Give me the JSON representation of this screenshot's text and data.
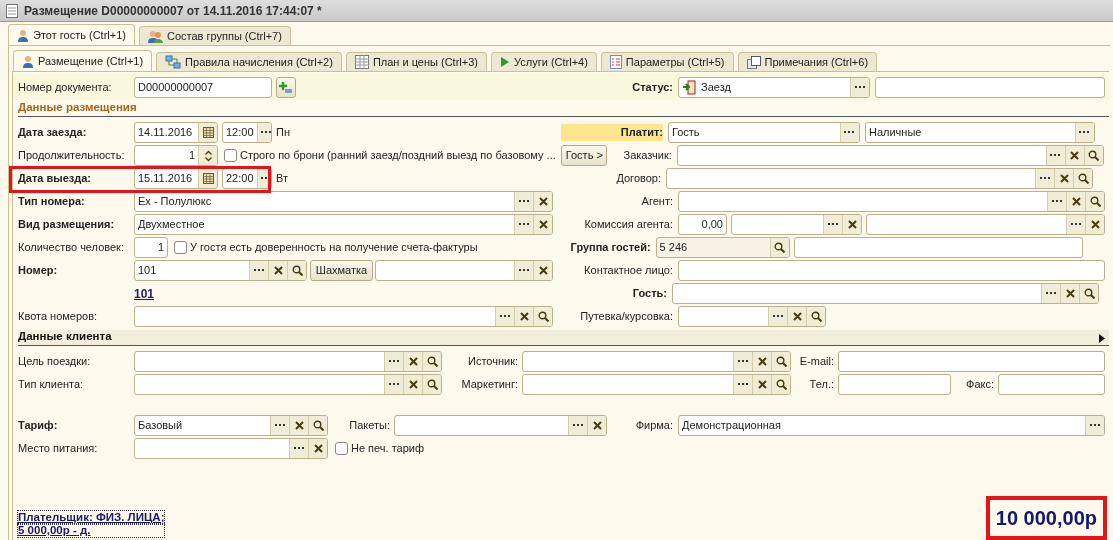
{
  "window": {
    "title": "Размещение D00000000007 от 14.11.2016 17:44:07 *"
  },
  "outer_tabs": [
    {
      "label": "Этот гость (Ctrl+1)",
      "selected": true
    },
    {
      "label": "Состав группы (Ctrl+7)",
      "selected": false
    }
  ],
  "tabs": [
    {
      "label": "Размещение (Ctrl+1)",
      "selected": true,
      "kind": "person"
    },
    {
      "label": "Правила начисления (Ctrl+2)",
      "selected": false,
      "kind": "rules"
    },
    {
      "label": "План и цены (Ctrl+3)",
      "selected": false,
      "kind": "table"
    },
    {
      "label": "Услуги (Ctrl+4)",
      "selected": false,
      "kind": "play"
    },
    {
      "label": "Параметры (Ctrl+5)",
      "selected": false,
      "kind": "list"
    },
    {
      "label": "Примечания (Ctrl+6)",
      "selected": false,
      "kind": "note"
    }
  ],
  "doc_number": {
    "label": "Номер документа:",
    "value": "D00000000007"
  },
  "status": {
    "label": "Статус:",
    "value": "Заезд"
  },
  "placement": {
    "title": "Данные размещения",
    "arrival": {
      "label": "Дата заезда:",
      "date": "14.11.2016",
      "time": "12:00",
      "weekday": "Пн"
    },
    "duration": {
      "label": "Продолжительность:",
      "value": "1"
    },
    "strict_booking": {
      "label": "Строго по брони (ранний заезд/поздний выезд по базовому ...",
      "checked": false
    },
    "guest_button": "Гость >",
    "departure": {
      "label": "Дата выезда:",
      "date": "15.11.2016",
      "time": "22:00",
      "weekday": "Вт",
      "highlighted": true
    },
    "room_type": {
      "label": "Тип номера:",
      "value": "Ex - Полулюкс"
    },
    "accommodation_type": {
      "label": "Вид размещения:",
      "value": "Двухместное"
    },
    "persons": {
      "label": "Количество человек:",
      "value": "1"
    },
    "power_of_attorney": {
      "label": "У гостя есть доверенность на получение счета-фактуры",
      "checked": false
    },
    "room": {
      "label": "Номер:",
      "value": "101"
    },
    "chessboard_button": "Шахматка",
    "room_link": "101",
    "room_quota": {
      "label": "Квота номеров:"
    },
    "payer": {
      "label": "Платит:",
      "value": "Гость",
      "method": "Наличные"
    },
    "customer": {
      "label": "Заказчик:"
    },
    "contract": {
      "label": "Договор:"
    },
    "agent": {
      "label": "Агент:"
    },
    "agent_commission": {
      "label": "Комиссия агента:",
      "value": "0,00"
    },
    "guest_group": {
      "label": "Группа гостей:",
      "value": "5 246"
    },
    "contact_person": {
      "label": "Контактное лицо:"
    },
    "guest": {
      "label": "Гость:"
    },
    "voucher": {
      "label": "Путевка/курсовка:"
    }
  },
  "client": {
    "title": "Данные клиента",
    "trip_purpose": {
      "label": "Цель поездки:"
    },
    "source": {
      "label": "Источник:"
    },
    "email": {
      "label": "E-mail:"
    },
    "client_type": {
      "label": "Тип клиента:"
    },
    "marketing": {
      "label": "Маркетинг:"
    },
    "phone": {
      "label": "Тел.:"
    },
    "fax": {
      "label": "Факс:"
    }
  },
  "rates": {
    "tariff": {
      "label": "Тариф:",
      "value": "Базовый"
    },
    "packages": {
      "label": "Пакеты:"
    },
    "firm": {
      "label": "Фирма:",
      "value": "Демонстрационная"
    },
    "meal_place": {
      "label": "Место питания:"
    },
    "no_print_tariff": {
      "label": "Не печ. тариф",
      "checked": false
    }
  },
  "footer": {
    "payer_lines": [
      "Плательщик: ФИЗ. ЛИЦА;",
      "5 000,00р - д."
    ],
    "total": "10 000,00р",
    "total_highlighted": true
  }
}
